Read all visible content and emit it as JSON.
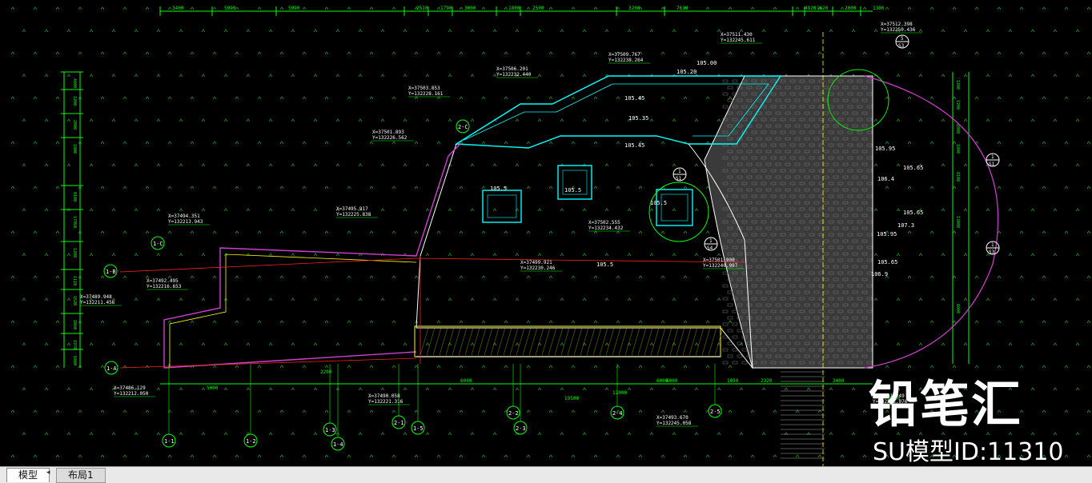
{
  "colors": {
    "background": "#000000",
    "grid_dots": "#1f8f1f",
    "dimension_green": "#00ff00",
    "outline_cyan": "#00ffff",
    "magenta": "#d040d0",
    "red_axis": "#ff2020",
    "white": "#ffffff",
    "yellow": "#ffff00"
  },
  "top_dimensions": [
    "3400",
    "5990",
    "5990",
    "2510",
    "1790",
    "3000",
    "1800",
    "2500",
    "3200",
    "7630",
    "4920",
    "1620",
    "2000",
    "1300"
  ],
  "left_dimensions": [
    "4800",
    "1200",
    "2000",
    "1800",
    "8100",
    "17950",
    "1280",
    "1110",
    "1520",
    "2860",
    "1970",
    "5800"
  ],
  "right_dimensions": [
    "1200",
    "1200",
    "2000",
    "1800",
    "8100",
    "13000",
    "6000"
  ],
  "coordinate_labels": [
    {
      "x": "X=37512.398",
      "y": "Y=132250.436"
    },
    {
      "x": "X=37511.430",
      "y": "Y=132245.611"
    },
    {
      "x": "X=37509.767",
      "y": "Y=132238.264"
    },
    {
      "x": "X=37506.201",
      "y": "Y=132232.440"
    },
    {
      "x": "X=37503.853",
      "y": "Y=132228.161"
    },
    {
      "x": "X=37501.893",
      "y": "Y=132226.562"
    },
    {
      "x": "X=37495.917",
      "y": "Y=132225.838"
    },
    {
      "x": "X=37494.351",
      "y": "Y=132213.943"
    },
    {
      "x": "X=37492.495",
      "y": "Y=132216.653"
    },
    {
      "x": "X=37489.948",
      "y": "Y=132211.456"
    },
    {
      "x": "X=37499.921",
      "y": "Y=132230.246"
    },
    {
      "x": "X=37502.555",
      "y": "Y=132234.432"
    },
    {
      "x": "X=37501.900",
      "y": "Y=132240.997"
    },
    {
      "x": "X=37490.058",
      "y": "Y=132221.316"
    },
    {
      "x": "X=37486.129",
      "y": "Y=132212.050"
    },
    {
      "x": "X=37493.670",
      "y": "Y=132245.058"
    },
    {
      "x": "X=37491.249",
      "y": "Y=132253.076"
    }
  ],
  "elevations": [
    "105.00",
    "105.20",
    "105.45",
    "105.35",
    "105.45",
    "105.5",
    "105.5",
    "105.5",
    "105.5",
    "105.95",
    "105.65",
    "106.4",
    "105.65",
    "107.3",
    "105.95",
    "105.65",
    "106.9"
  ],
  "axis_labels_left": [
    "1-C",
    "1-B",
    "1-A"
  ],
  "axis_labels_bottom": [
    "1-1",
    "1-2",
    "1-3",
    "1-4",
    "1-5",
    "2-1",
    "2-2",
    "2-3",
    "2-4",
    "2-5"
  ],
  "axis_label_top": "2-C",
  "bottom_dimensions": [
    "5000",
    "2200",
    "6000",
    "6000",
    "19500",
    "12000",
    "6000",
    "1050",
    "2320",
    "2400",
    "6650"
  ],
  "section_markers": [
    "5 S3",
    "1 S1",
    "1 S3",
    "1 S4",
    "1 S1"
  ],
  "tabs": {
    "model": "模型",
    "layout1": "布局1"
  },
  "watermark": {
    "brand": "铅笔汇",
    "model_id": "SU模型ID:11310"
  }
}
